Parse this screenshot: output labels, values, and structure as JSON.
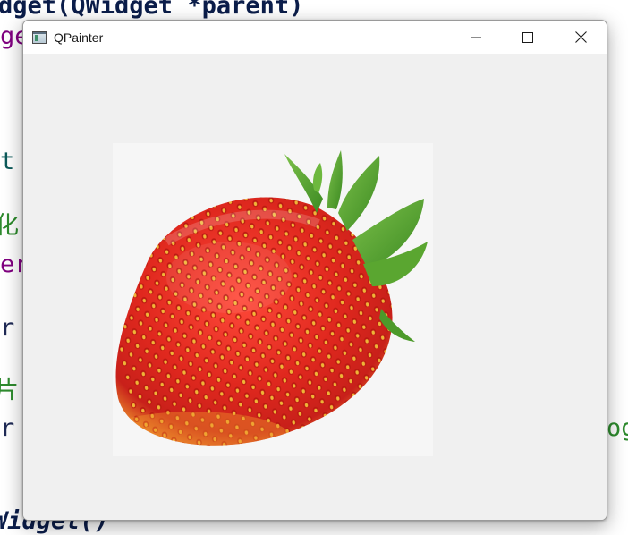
{
  "editor": {
    "line1": "dget(QWidget *parent)",
    "line2": "ge",
    "line3": "t",
    "line4": "化",
    "line5": "er",
    "line6": "r",
    "line7": "片",
    "line8": "r",
    "line8_tail": "og",
    "line9": "Widget()"
  },
  "window": {
    "title": "QPainter",
    "icon": "qt-window-icon"
  },
  "controls": {
    "minimize": "minimize-icon",
    "maximize": "maximize-icon",
    "close": "close-icon"
  },
  "image": {
    "subject": "strawberry-image"
  },
  "colors": {
    "window_bg": "#f0f0f0",
    "titlebar_bg": "#ffffff",
    "strawberry_red": "#e0281e",
    "leaf_green": "#4c9a2a"
  }
}
